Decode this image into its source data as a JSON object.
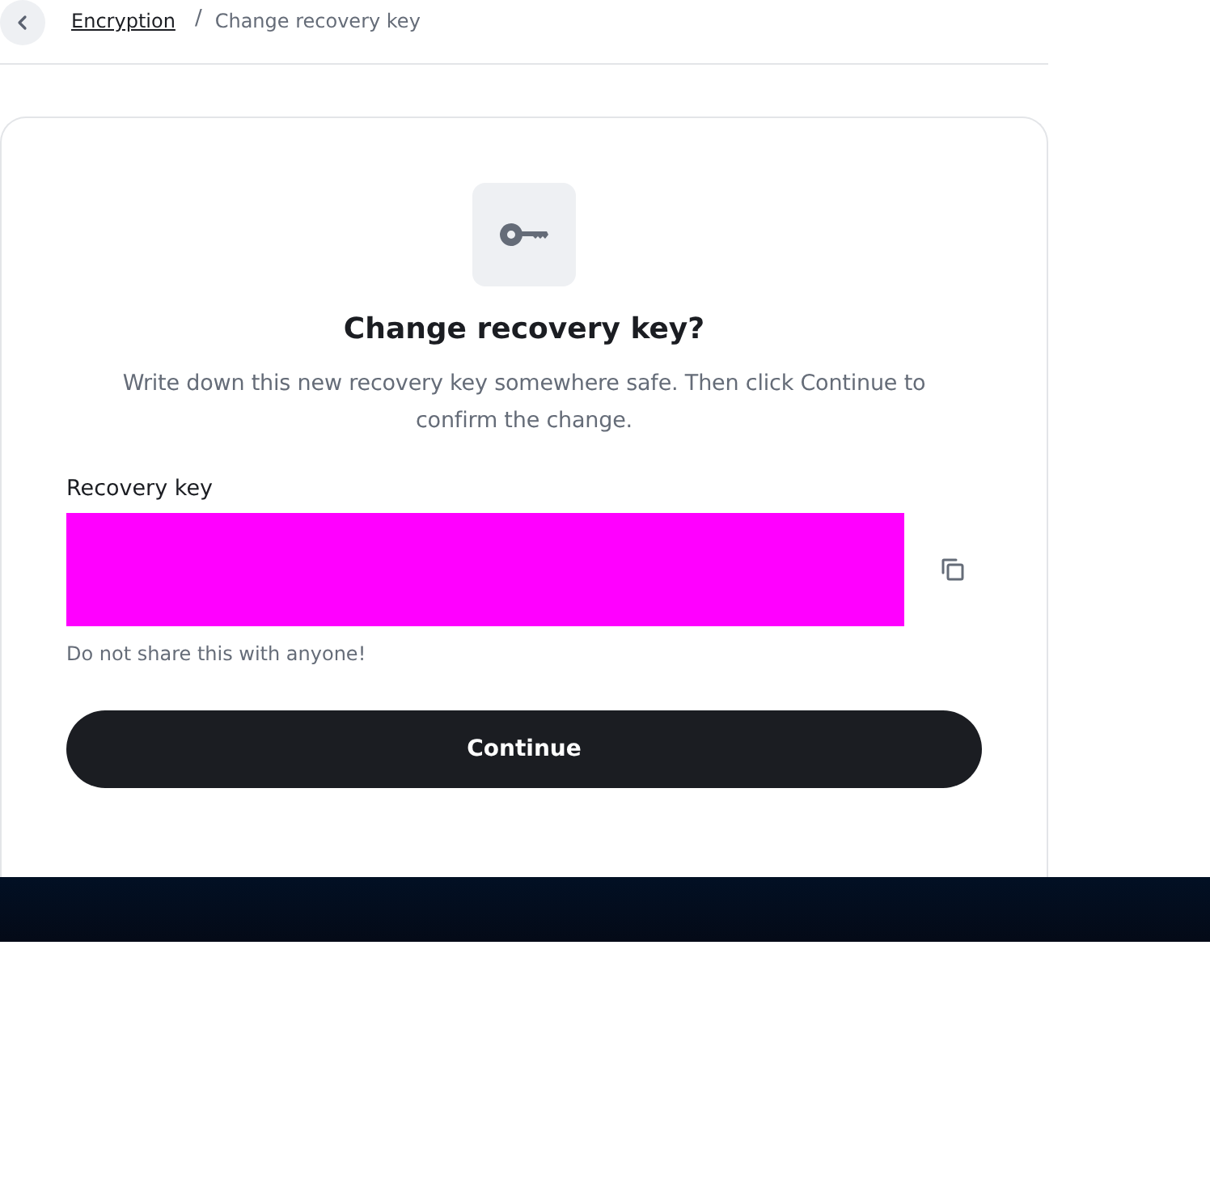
{
  "breadcrumb": {
    "parent": "Encryption",
    "current": "Change recovery key",
    "separator": "/"
  },
  "card": {
    "title": "Change recovery key?",
    "description": "Write down this new recovery key somewhere safe. Then click Continue to confirm the change.",
    "field_label": "Recovery key",
    "hint": "Do not share this with anyone!",
    "button": "Continue"
  }
}
